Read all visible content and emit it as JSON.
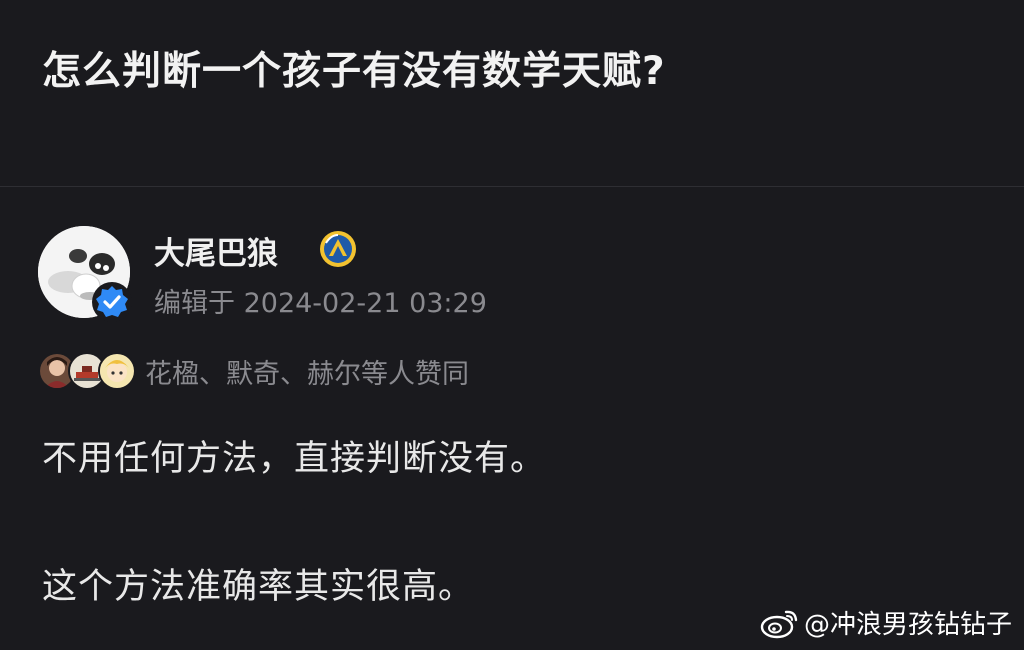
{
  "question": {
    "title": "怎么判断一个孩子有没有数学天赋?"
  },
  "answer": {
    "author": {
      "name": "大尾巴狼",
      "avatar": "avatar",
      "verified_icon": "verified-check-icon",
      "medal_icon": "medal-icon"
    },
    "edit_time": "编辑于 2024-02-21 03:29",
    "voters": {
      "avatars": [
        "voter-avatar-1",
        "voter-avatar-2",
        "voter-avatar-3"
      ],
      "text": "花楹、默奇、赫尔等人赞同"
    },
    "paragraphs": [
      "不用任何方法，直接判断没有。",
      "这个方法准确率其实很高。"
    ]
  },
  "watermark": {
    "logo": "weibo-logo-icon",
    "text": "@冲浪男孩钻钻子"
  },
  "colors": {
    "background": "#1a1a1e",
    "text_primary": "#ececec",
    "text_secondary": "#8a8a8f",
    "verified_blue": "#2f8af5",
    "divider": "#2e2e33"
  }
}
